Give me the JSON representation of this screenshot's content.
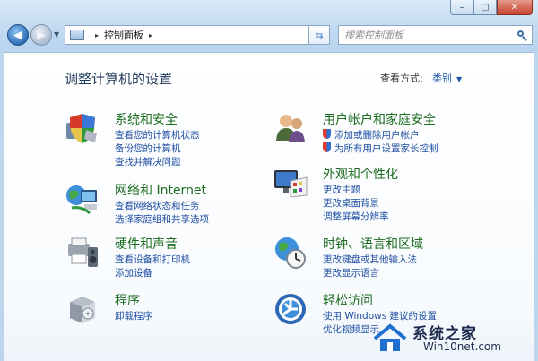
{
  "window": {
    "controls": {
      "minimize": "–",
      "maximize": "▢",
      "close": "✕"
    }
  },
  "address": {
    "root_sep": "▸",
    "path": "控制面板",
    "path_sep": "▸"
  },
  "search": {
    "placeholder": "搜索控制面板"
  },
  "content": {
    "title": "调整计算机的设置",
    "view_by_label": "查看方式:",
    "view_by_value": "类别"
  },
  "categories": [
    {
      "title": "系统和安全",
      "links": [
        "查看您的计算机状态",
        "备份您的计算机",
        "查找并解决问题"
      ]
    },
    {
      "title": "网络和 Internet",
      "links": [
        "查看网络状态和任务",
        "选择家庭组和共享选项"
      ]
    },
    {
      "title": "硬件和声音",
      "links": [
        "查看设备和打印机",
        "添加设备"
      ]
    },
    {
      "title": "程序",
      "links": [
        "卸载程序"
      ]
    },
    {
      "title": "用户帐户和家庭安全",
      "links": [
        "添加或删除用户帐户",
        "为所有用户设置家长控制"
      ]
    },
    {
      "title": "外观和个性化",
      "links": [
        "更改主题",
        "更改桌面背景",
        "调整屏幕分辨率"
      ]
    },
    {
      "title": "时钟、语言和区域",
      "links": [
        "更改键盘或其他输入法",
        "更改显示语言"
      ]
    },
    {
      "title": "轻松访问",
      "links": [
        "使用 Windows 建议的设置",
        "优化视频显示"
      ]
    }
  ],
  "watermark": {
    "brand": "系统之家",
    "site": "Win10net.com"
  },
  "colors": {
    "category_title": "#1a6b1e",
    "link": "#1f4fa2",
    "page_title": "#1e395b"
  }
}
